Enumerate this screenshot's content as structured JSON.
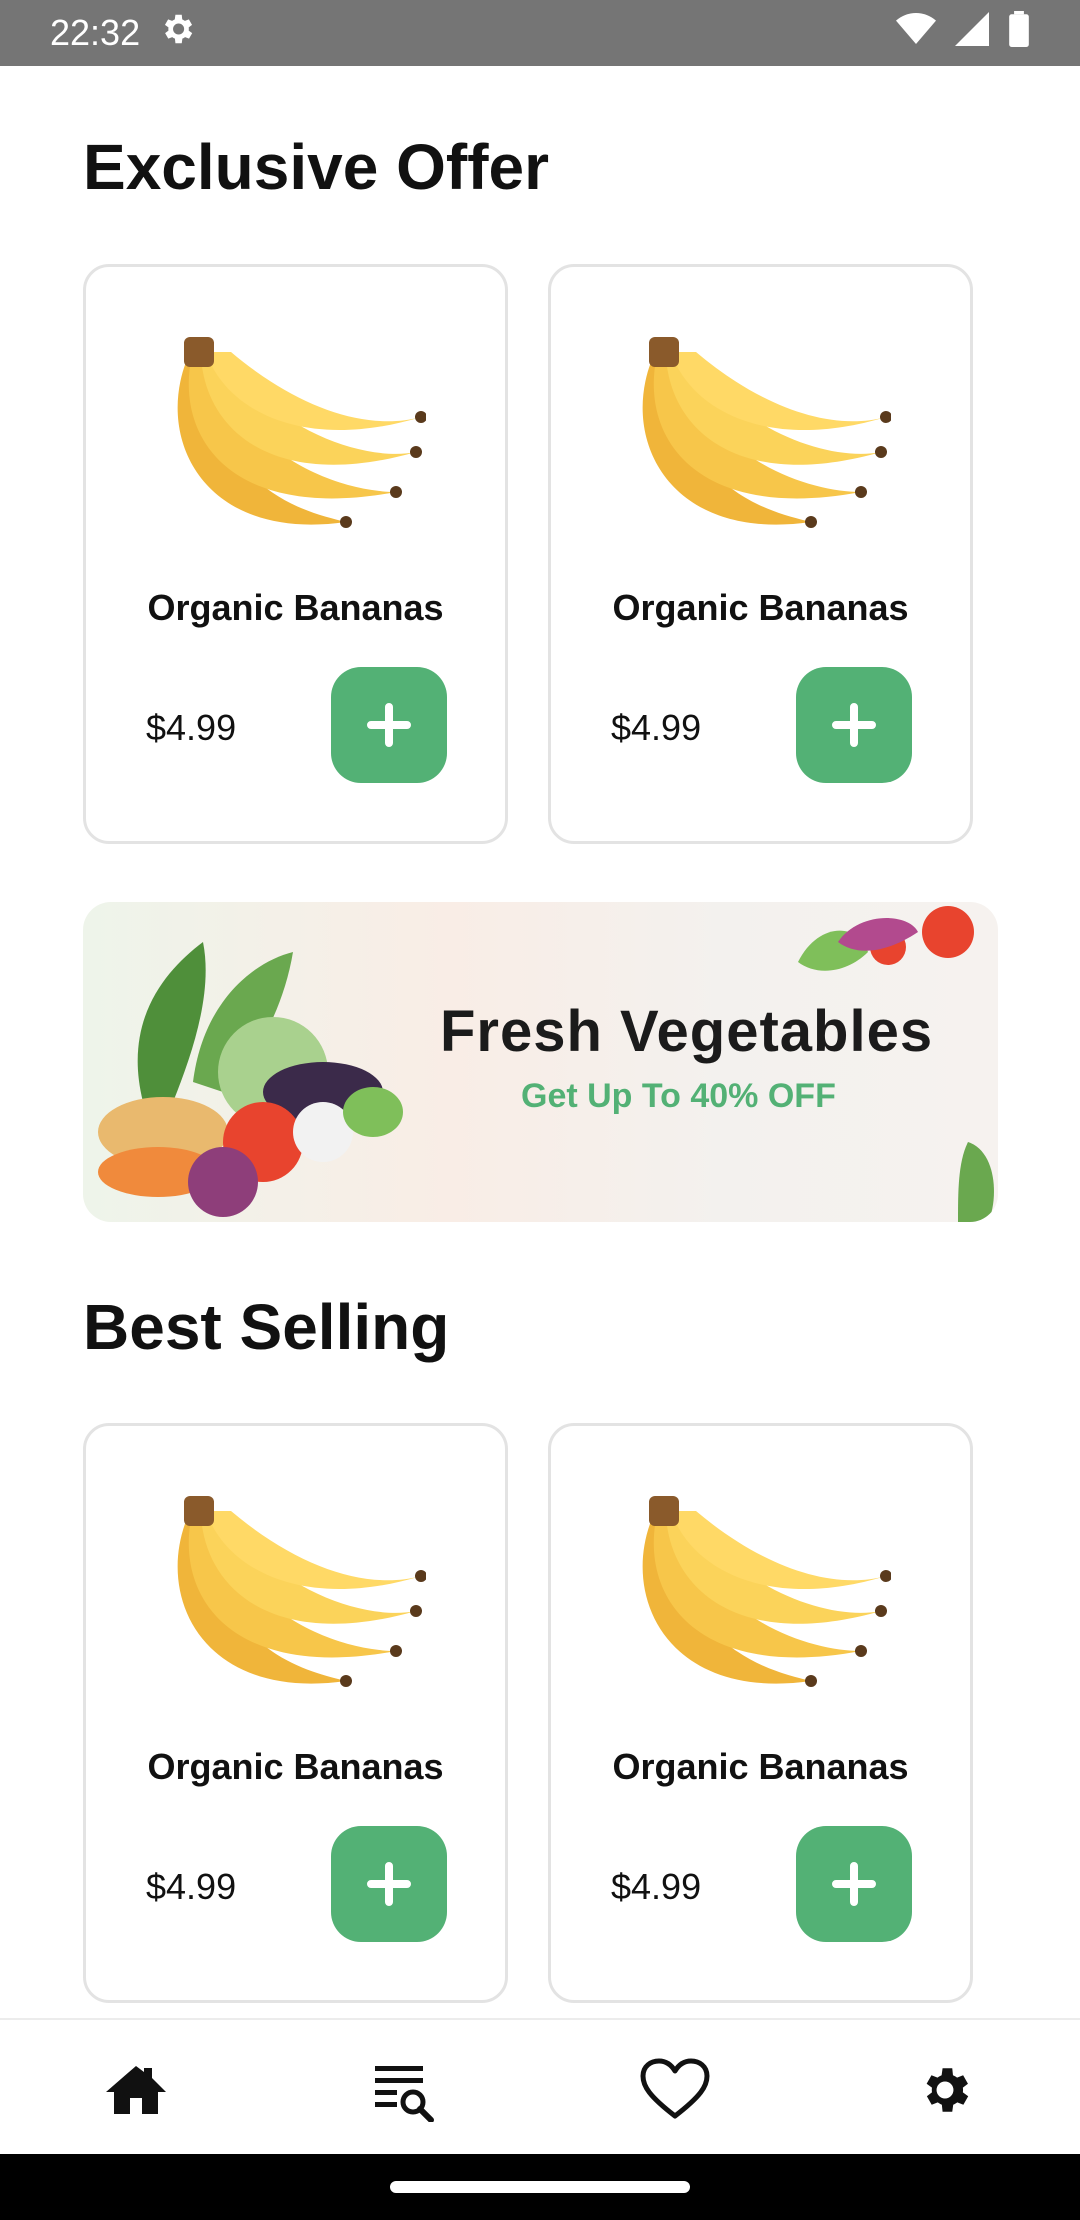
{
  "status_bar": {
    "time": "22:32",
    "icons": [
      "settings-icon",
      "wifi-icon",
      "signal-icon",
      "battery-icon"
    ]
  },
  "sections": {
    "exclusive_offer": {
      "title": "Exclusive Offer",
      "products": [
        {
          "name": "Organic Bananas",
          "price": "$4.99",
          "image": "banana-icon"
        },
        {
          "name": "Organic Bananas",
          "price": "$4.99",
          "image": "banana-icon"
        }
      ]
    },
    "banner": {
      "title": "Fresh Vegetables",
      "subtitle": "Get Up To 40% OFF"
    },
    "best_selling": {
      "title": "Best Selling",
      "products": [
        {
          "name": "Organic Bananas",
          "price": "$4.99",
          "image": "banana-icon"
        },
        {
          "name": "Organic Bananas",
          "price": "$4.99",
          "image": "banana-icon"
        }
      ]
    }
  },
  "bottom_nav": {
    "items": [
      {
        "icon": "home-icon"
      },
      {
        "icon": "search-list-icon"
      },
      {
        "icon": "heart-icon"
      },
      {
        "icon": "gear-icon"
      }
    ]
  },
  "colors": {
    "accent": "#53b175",
    "status_bar": "#757575",
    "text": "#111111",
    "card_border": "#e3e3e3"
  }
}
